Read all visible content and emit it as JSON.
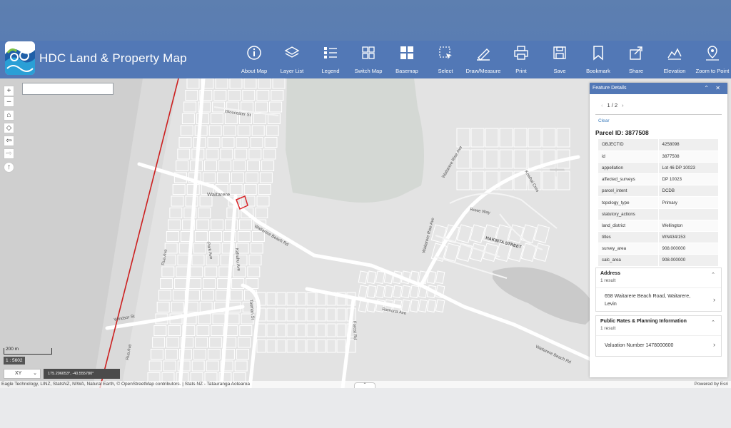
{
  "header": {
    "title": "HDC Land & Property Map",
    "tools": [
      {
        "label": "About Map",
        "icon": "info-icon"
      },
      {
        "label": "Layer List",
        "icon": "layers-icon"
      },
      {
        "label": "Legend",
        "icon": "legend-icon"
      },
      {
        "label": "Switch Map",
        "icon": "switch-map-icon"
      },
      {
        "label": "Basemap",
        "icon": "basemap-icon"
      },
      {
        "label": "Select",
        "icon": "select-icon"
      },
      {
        "label": "Draw/Measure",
        "icon": "draw-icon"
      },
      {
        "label": "Print",
        "icon": "print-icon"
      },
      {
        "label": "Save",
        "icon": "save-icon"
      },
      {
        "label": "Bookmark",
        "icon": "bookmark-icon"
      },
      {
        "label": "Share",
        "icon": "share-icon"
      },
      {
        "label": "Elevation",
        "icon": "elevation-icon"
      },
      {
        "label": "Zoom to Point",
        "icon": "zoom-point-icon"
      }
    ]
  },
  "map": {
    "search_value": "",
    "nav_buttons": [
      "+",
      "–",
      "⌂",
      "◇",
      "⇦",
      "⇨",
      "↑"
    ],
    "scale_label": "200 m",
    "scale_ratio": "1 : 5602",
    "coord_system": "XY",
    "coord_value": "175.206053°, -40.555780°",
    "attribution": "Eagle Technology, LINZ, StatsNZ, NIWA, Natural Earth, © OpenStreetMap contributors. | Stats NZ - Tatauranga Aotearoa",
    "powered_by": "Powered by Esri",
    "street_labels": [
      "Gloucester St",
      "Waitarere",
      "Waitarere Beach Rd",
      "Park Ave",
      "Kahuhu Ave",
      "Rua Ave",
      "Windsor St",
      "Waitarere Rise Ave",
      "Kowhai Cres",
      "Rowe Way",
      "HAKINTA STREET",
      "Ramona Ave",
      "Forest Rd",
      "Tasman St",
      "Rua Ave"
    ]
  },
  "panel": {
    "title": "Feature Details",
    "pager": "1 / 2",
    "clear_label": "Clear",
    "parcel_heading": "Parcel ID: 3877508",
    "attributes": [
      {
        "key": "OBJECTID",
        "value": "4258098"
      },
      {
        "key": "id",
        "value": "3877508"
      },
      {
        "key": "appellation",
        "value": "Lot 46 DP 10023"
      },
      {
        "key": "affected_surveys",
        "value": "DP 10023"
      },
      {
        "key": "parcel_intent",
        "value": "DCDB"
      },
      {
        "key": "topology_type",
        "value": "Primary"
      },
      {
        "key": "statutory_actions",
        "value": ""
      },
      {
        "key": "land_district",
        "value": "Wellington"
      },
      {
        "key": "titles",
        "value": "WN434/153"
      },
      {
        "key": "survey_area",
        "value": "908.000000"
      },
      {
        "key": "calc_area",
        "value": "908.000000"
      }
    ],
    "address": {
      "title": "Address",
      "count": "1 result",
      "line1": "658 Waitarere Beach Road, Waitarere,",
      "line2": "Levin"
    },
    "rates": {
      "title": "Public Rates & Planning Information",
      "count": "1 result",
      "item": "Valuation Number 1478000600"
    }
  },
  "colors": {
    "header_bg": "#5278b6",
    "parcel_outline": "#d9262a",
    "boundary_line": "#cc1f1f"
  }
}
